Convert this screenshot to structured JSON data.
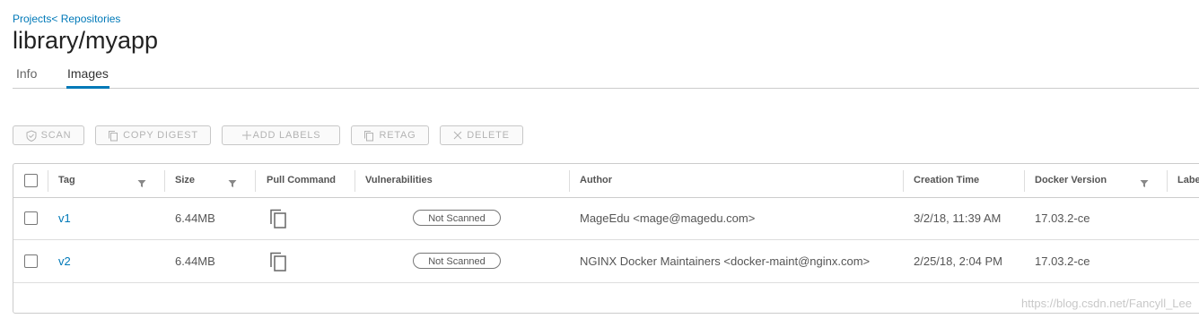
{
  "breadcrumb": {
    "projects": "Projects",
    "sep": "<",
    "repositories": " Repositories"
  },
  "page_title": "library/myapp",
  "tabs": {
    "info": "Info",
    "images": "Images"
  },
  "toolbar": {
    "scan": "SCAN",
    "copy_digest": "COPY DIGEST",
    "add_labels": "ADD LABELS",
    "retag": "RETAG",
    "delete": "DELETE"
  },
  "table": {
    "columns": {
      "tag": "Tag",
      "size": "Size",
      "pull_command": "Pull Command",
      "vulnerabilities": "Vulnerabilities",
      "author": "Author",
      "creation_time": "Creation Time",
      "docker_version": "Docker Version",
      "labels": "Labe"
    },
    "rows": [
      {
        "tag": "v1",
        "size": "6.44MB",
        "vulnerabilities": "Not Scanned",
        "author": "MageEdu <mage@magedu.com>",
        "creation_time": "3/2/18, 11:39 AM",
        "docker_version": "17.03.2-ce"
      },
      {
        "tag": "v2",
        "size": "6.44MB",
        "vulnerabilities": "Not Scanned",
        "author": "NGINX Docker Maintainers <docker-maint@nginx.com>",
        "creation_time": "2/25/18, 2:04 PM",
        "docker_version": "17.03.2-ce"
      }
    ]
  },
  "watermark": "https://blog.csdn.net/Fancyll_Lee",
  "colors": {
    "accent": "#0079b8",
    "border": "#cccccc",
    "disabled_text": "#b3b3b3"
  },
  "icons": [
    "shield-icon",
    "copy-icon",
    "plus-icon",
    "close-icon",
    "filter-icon",
    "clipboard-icon"
  ]
}
